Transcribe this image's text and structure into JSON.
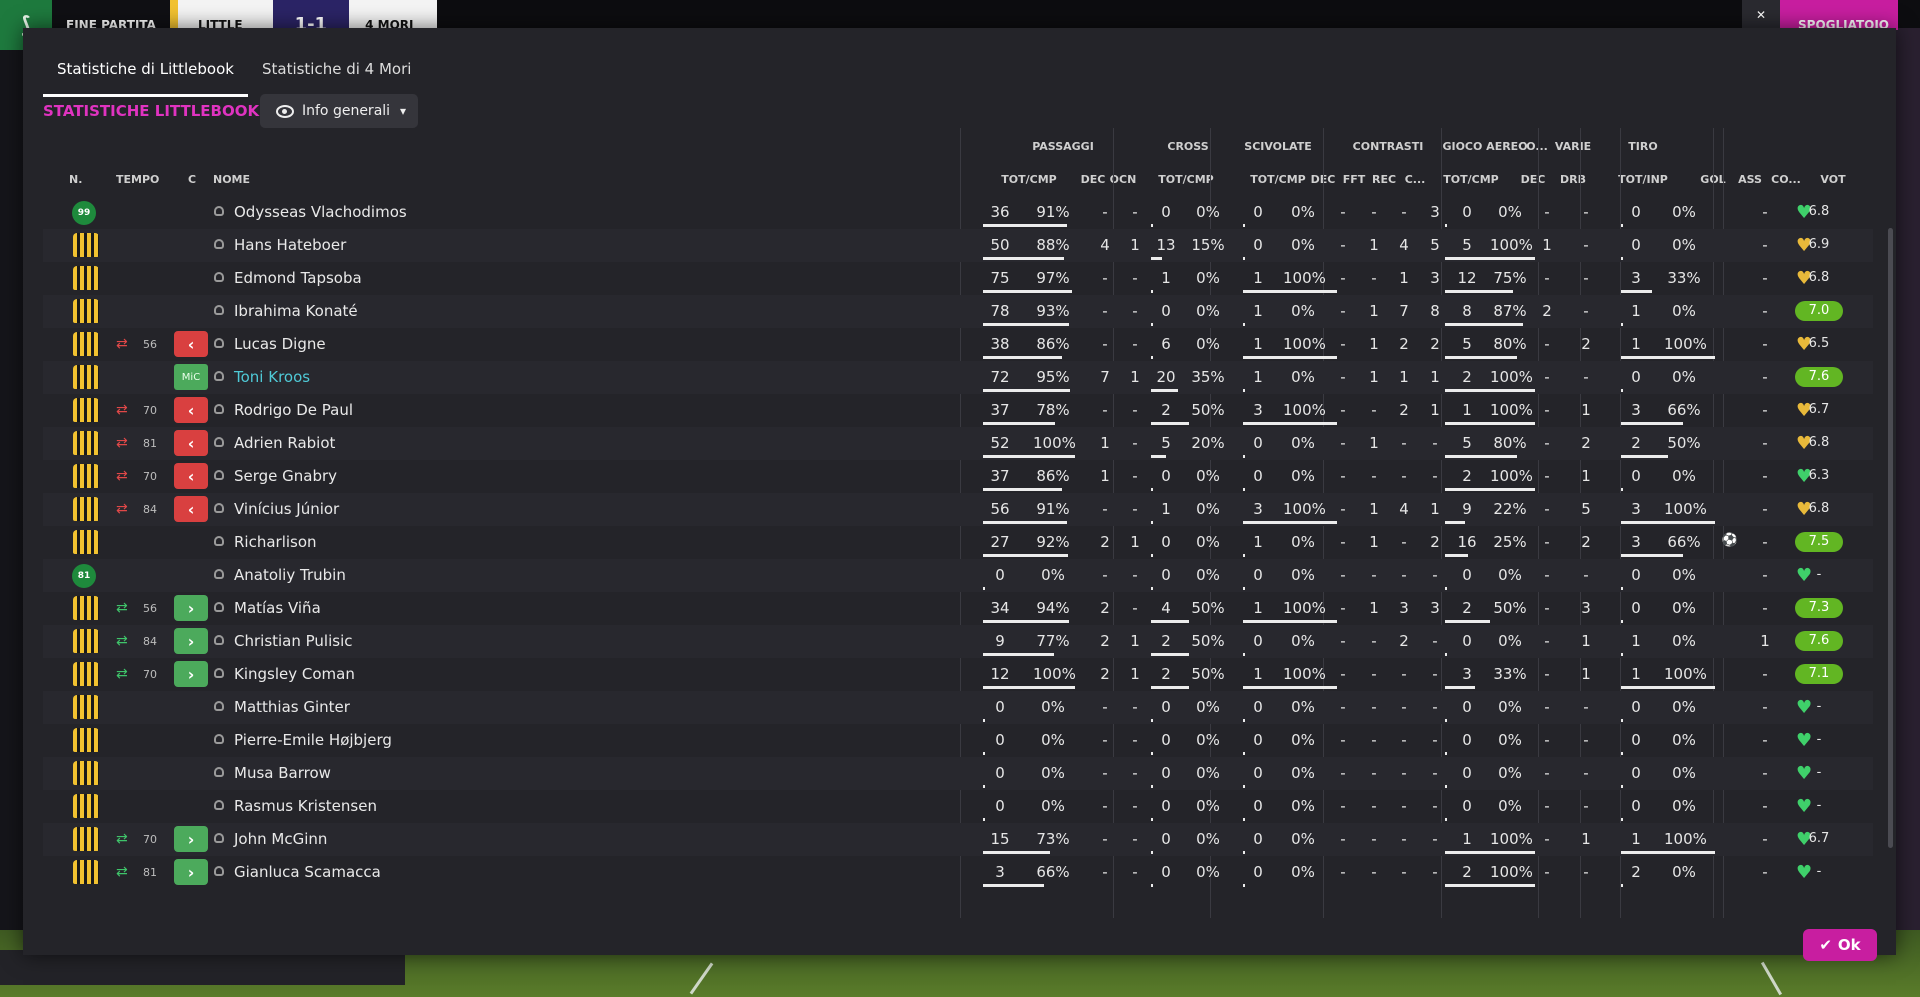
{
  "scoreboard": {
    "label": "FINE PARTITA",
    "home": "LITTLE",
    "score": "1-1",
    "away": "4 MORI",
    "close": "✕",
    "right_button": "SPOGLIATOIO"
  },
  "tabs": [
    "Statistiche di Littlebook",
    "Statistiche di 4 Mori"
  ],
  "section_title": "STATISTICHE LITTLEBOOK",
  "view_button": "Info generali",
  "ok_label": "Ok",
  "colors": {
    "accent": "#c81ea0",
    "home_kit": "#f2c230",
    "rating_high": "#62b623"
  },
  "columns": {
    "fixed": [
      "N.",
      "TEMPO",
      "C",
      "NOME"
    ],
    "groups": [
      {
        "label": "PASSAGGI",
        "subs": [
          "TOT/CMP",
          "DEC",
          "OCN"
        ]
      },
      {
        "label": "CROSS",
        "subs": [
          "TOT/CMP"
        ]
      },
      {
        "label": "SCIVOLATE",
        "subs": [
          "TOT/CMP"
        ]
      },
      {
        "label": "CONTRASTI",
        "subs": [
          "DEC",
          "FFT",
          "REC",
          "C..."
        ]
      },
      {
        "label": "GIOCO AEREO",
        "subs": [
          "TOT/CMP"
        ]
      },
      {
        "label": "CO...",
        "subs": [
          "DEC"
        ]
      },
      {
        "label": "VARIE",
        "subs": [
          "DRB"
        ]
      },
      {
        "label": "TIRO",
        "subs": [
          "TOT/INP"
        ]
      },
      {
        "label": "",
        "subs": [
          "GOL",
          "ASS",
          "CO...",
          "VOT"
        ]
      }
    ]
  },
  "players": [
    {
      "n": "99",
      "gk": true,
      "tempo": "",
      "sub": "",
      "name": "Odysseas Vlachodimos",
      "pass": [
        "36",
        "91%"
      ],
      "pdec": "-",
      "pocn": "-",
      "cross": [
        "0",
        "0%"
      ],
      "sciv": [
        "0",
        "0%"
      ],
      "con": [
        "-",
        "-",
        "-",
        "3"
      ],
      "aereo": [
        "0",
        "0%"
      ],
      "codec": "-",
      "drb": "-",
      "tiro": [
        "0",
        "0%"
      ],
      "gol": "",
      "ass": "-",
      "heart": "green",
      "vot": "6.8"
    },
    {
      "n": "",
      "gk": false,
      "tempo": "",
      "sub": "",
      "name": "Hans Hateboer",
      "pass": [
        "50",
        "88%"
      ],
      "pdec": "4",
      "pocn": "1",
      "cross": [
        "13",
        "15%"
      ],
      "sciv": [
        "0",
        "0%"
      ],
      "con": [
        "-",
        "1",
        "4",
        "5"
      ],
      "aereo": [
        "5",
        "100%"
      ],
      "codec": "1",
      "drb": "-",
      "tiro": [
        "0",
        "0%"
      ],
      "gol": "",
      "ass": "-",
      "heart": "gold",
      "vot": "6.9"
    },
    {
      "n": "",
      "gk": false,
      "tempo": "",
      "sub": "",
      "name": "Edmond Tapsoba",
      "pass": [
        "75",
        "97%"
      ],
      "pdec": "-",
      "pocn": "-",
      "cross": [
        "1",
        "0%"
      ],
      "sciv": [
        "1",
        "100%"
      ],
      "con": [
        "-",
        "-",
        "1",
        "3"
      ],
      "aereo": [
        "12",
        "75%"
      ],
      "codec": "-",
      "drb": "-",
      "tiro": [
        "3",
        "33%"
      ],
      "gol": "",
      "ass": "-",
      "heart": "gold",
      "vot": "6.8"
    },
    {
      "n": "",
      "gk": false,
      "tempo": "",
      "sub": "",
      "name": "Ibrahima Konaté",
      "pass": [
        "78",
        "93%"
      ],
      "pdec": "-",
      "pocn": "-",
      "cross": [
        "0",
        "0%"
      ],
      "sciv": [
        "1",
        "0%"
      ],
      "con": [
        "-",
        "1",
        "7",
        "8"
      ],
      "aereo": [
        "8",
        "87%"
      ],
      "codec": "2",
      "drb": "-",
      "tiro": [
        "1",
        "0%"
      ],
      "gol": "",
      "ass": "-",
      "heart": "gold",
      "vot": "7.0"
    },
    {
      "n": "",
      "gk": false,
      "tempo": "56",
      "sub": "out",
      "name": "Lucas Digne",
      "pass": [
        "38",
        "86%"
      ],
      "pdec": "-",
      "pocn": "-",
      "cross": [
        "6",
        "0%"
      ],
      "sciv": [
        "1",
        "100%"
      ],
      "con": [
        "-",
        "1",
        "2",
        "2"
      ],
      "aereo": [
        "5",
        "80%"
      ],
      "codec": "-",
      "drb": "2",
      "tiro": [
        "1",
        "100%"
      ],
      "gol": "",
      "ass": "-",
      "heart": "gold",
      "vot": "6.5"
    },
    {
      "n": "",
      "gk": false,
      "tempo": "",
      "sub": "MiC",
      "name": "Toni Kroos",
      "pass": [
        "72",
        "95%"
      ],
      "pdec": "7",
      "pocn": "1",
      "cross": [
        "20",
        "35%"
      ],
      "sciv": [
        "1",
        "0%"
      ],
      "con": [
        "-",
        "1",
        "1",
        "1"
      ],
      "aereo": [
        "2",
        "100%"
      ],
      "codec": "-",
      "drb": "-",
      "tiro": [
        "0",
        "0%"
      ],
      "gol": "",
      "ass": "-",
      "heart": "gold",
      "vot": "7.6"
    },
    {
      "n": "",
      "gk": false,
      "tempo": "70",
      "sub": "out",
      "name": "Rodrigo De Paul",
      "pass": [
        "37",
        "78%"
      ],
      "pdec": "-",
      "pocn": "-",
      "cross": [
        "2",
        "50%"
      ],
      "sciv": [
        "3",
        "100%"
      ],
      "con": [
        "-",
        "-",
        "2",
        "1"
      ],
      "aereo": [
        "1",
        "100%"
      ],
      "codec": "-",
      "drb": "1",
      "tiro": [
        "3",
        "66%"
      ],
      "gol": "",
      "ass": "-",
      "heart": "gold",
      "vot": "6.7"
    },
    {
      "n": "",
      "gk": false,
      "tempo": "81",
      "sub": "out",
      "name": "Adrien Rabiot",
      "pass": [
        "52",
        "100%"
      ],
      "pdec": "1",
      "pocn": "-",
      "cross": [
        "5",
        "20%"
      ],
      "sciv": [
        "0",
        "0%"
      ],
      "con": [
        "-",
        "1",
        "-",
        "-"
      ],
      "aereo": [
        "5",
        "80%"
      ],
      "codec": "-",
      "drb": "2",
      "tiro": [
        "2",
        "50%"
      ],
      "gol": "",
      "ass": "-",
      "heart": "gold",
      "vot": "6.8"
    },
    {
      "n": "",
      "gk": false,
      "tempo": "70",
      "sub": "out",
      "name": "Serge Gnabry",
      "pass": [
        "37",
        "86%"
      ],
      "pdec": "1",
      "pocn": "-",
      "cross": [
        "0",
        "0%"
      ],
      "sciv": [
        "0",
        "0%"
      ],
      "con": [
        "-",
        "-",
        "-",
        "-"
      ],
      "aereo": [
        "2",
        "100%"
      ],
      "codec": "-",
      "drb": "1",
      "tiro": [
        "0",
        "0%"
      ],
      "gol": "",
      "ass": "-",
      "heart": "green",
      "vot": "6.3"
    },
    {
      "n": "",
      "gk": false,
      "tempo": "84",
      "sub": "out",
      "name": "Vinícius Júnior",
      "pass": [
        "56",
        "91%"
      ],
      "pdec": "-",
      "pocn": "-",
      "cross": [
        "1",
        "0%"
      ],
      "sciv": [
        "3",
        "100%"
      ],
      "con": [
        "-",
        "1",
        "4",
        "1"
      ],
      "aereo": [
        "9",
        "22%"
      ],
      "codec": "-",
      "drb": "5",
      "tiro": [
        "3",
        "100%"
      ],
      "gol": "",
      "ass": "-",
      "heart": "gold",
      "vot": "6.8"
    },
    {
      "n": "",
      "gk": false,
      "tempo": "",
      "sub": "",
      "name": "Richarlison",
      "pass": [
        "27",
        "92%"
      ],
      "pdec": "2",
      "pocn": "1",
      "cross": [
        "0",
        "0%"
      ],
      "sciv": [
        "1",
        "0%"
      ],
      "con": [
        "-",
        "1",
        "-",
        "2"
      ],
      "aereo": [
        "16",
        "25%"
      ],
      "codec": "-",
      "drb": "2",
      "tiro": [
        "3",
        "66%"
      ],
      "gol": "⚽",
      "ass": "-",
      "heart": "gold",
      "vot": "7.5"
    },
    {
      "n": "81",
      "gk": true,
      "tempo": "",
      "sub": "",
      "name": "Anatoliy Trubin",
      "pass": [
        "0",
        "0%"
      ],
      "pdec": "-",
      "pocn": "-",
      "cross": [
        "0",
        "0%"
      ],
      "sciv": [
        "0",
        "0%"
      ],
      "con": [
        "-",
        "-",
        "-",
        "-"
      ],
      "aereo": [
        "0",
        "0%"
      ],
      "codec": "-",
      "drb": "-",
      "tiro": [
        "0",
        "0%"
      ],
      "gol": "",
      "ass": "-",
      "heart": "green",
      "vot": "-"
    },
    {
      "n": "",
      "gk": false,
      "tempo": "56",
      "sub": "in",
      "name": "Matías Viña",
      "pass": [
        "34",
        "94%"
      ],
      "pdec": "2",
      "pocn": "-",
      "cross": [
        "4",
        "50%"
      ],
      "sciv": [
        "1",
        "100%"
      ],
      "con": [
        "-",
        "1",
        "3",
        "3"
      ],
      "aereo": [
        "2",
        "50%"
      ],
      "codec": "-",
      "drb": "3",
      "tiro": [
        "0",
        "0%"
      ],
      "gol": "",
      "ass": "-",
      "heart": "green",
      "vot": "7.3"
    },
    {
      "n": "",
      "gk": false,
      "tempo": "84",
      "sub": "in",
      "name": "Christian Pulisic",
      "pass": [
        "9",
        "77%"
      ],
      "pdec": "2",
      "pocn": "1",
      "cross": [
        "2",
        "50%"
      ],
      "sciv": [
        "0",
        "0%"
      ],
      "con": [
        "-",
        "-",
        "2",
        "-"
      ],
      "aereo": [
        "0",
        "0%"
      ],
      "codec": "-",
      "drb": "1",
      "tiro": [
        "1",
        "0%"
      ],
      "gol": "",
      "ass": "1",
      "heart": "green",
      "vot": "7.6"
    },
    {
      "n": "",
      "gk": false,
      "tempo": "70",
      "sub": "in",
      "name": "Kingsley Coman",
      "pass": [
        "12",
        "100%"
      ],
      "pdec": "2",
      "pocn": "1",
      "cross": [
        "2",
        "50%"
      ],
      "sciv": [
        "1",
        "100%"
      ],
      "con": [
        "-",
        "-",
        "-",
        "-"
      ],
      "aereo": [
        "3",
        "33%"
      ],
      "codec": "-",
      "drb": "1",
      "tiro": [
        "1",
        "100%"
      ],
      "gol": "",
      "ass": "-",
      "heart": "green",
      "vot": "7.1"
    },
    {
      "n": "",
      "gk": false,
      "tempo": "",
      "sub": "",
      "name": "Matthias Ginter",
      "pass": [
        "0",
        "0%"
      ],
      "pdec": "-",
      "pocn": "-",
      "cross": [
        "0",
        "0%"
      ],
      "sciv": [
        "0",
        "0%"
      ],
      "con": [
        "-",
        "-",
        "-",
        "-"
      ],
      "aereo": [
        "0",
        "0%"
      ],
      "codec": "-",
      "drb": "-",
      "tiro": [
        "0",
        "0%"
      ],
      "gol": "",
      "ass": "-",
      "heart": "green",
      "vot": "-"
    },
    {
      "n": "",
      "gk": false,
      "tempo": "",
      "sub": "",
      "name": "Pierre-Emile Højbjerg",
      "pass": [
        "0",
        "0%"
      ],
      "pdec": "-",
      "pocn": "-",
      "cross": [
        "0",
        "0%"
      ],
      "sciv": [
        "0",
        "0%"
      ],
      "con": [
        "-",
        "-",
        "-",
        "-"
      ],
      "aereo": [
        "0",
        "0%"
      ],
      "codec": "-",
      "drb": "-",
      "tiro": [
        "0",
        "0%"
      ],
      "gol": "",
      "ass": "-",
      "heart": "green",
      "vot": "-"
    },
    {
      "n": "",
      "gk": false,
      "tempo": "",
      "sub": "",
      "name": "Musa Barrow",
      "pass": [
        "0",
        "0%"
      ],
      "pdec": "-",
      "pocn": "-",
      "cross": [
        "0",
        "0%"
      ],
      "sciv": [
        "0",
        "0%"
      ],
      "con": [
        "-",
        "-",
        "-",
        "-"
      ],
      "aereo": [
        "0",
        "0%"
      ],
      "codec": "-",
      "drb": "-",
      "tiro": [
        "0",
        "0%"
      ],
      "gol": "",
      "ass": "-",
      "heart": "green",
      "vot": "-"
    },
    {
      "n": "",
      "gk": false,
      "tempo": "",
      "sub": "",
      "name": "Rasmus Kristensen",
      "pass": [
        "0",
        "0%"
      ],
      "pdec": "-",
      "pocn": "-",
      "cross": [
        "0",
        "0%"
      ],
      "sciv": [
        "0",
        "0%"
      ],
      "con": [
        "-",
        "-",
        "-",
        "-"
      ],
      "aereo": [
        "0",
        "0%"
      ],
      "codec": "-",
      "drb": "-",
      "tiro": [
        "0",
        "0%"
      ],
      "gol": "",
      "ass": "-",
      "heart": "green",
      "vot": "-"
    },
    {
      "n": "",
      "gk": false,
      "tempo": "70",
      "sub": "in",
      "name": "John McGinn",
      "pass": [
        "15",
        "73%"
      ],
      "pdec": "-",
      "pocn": "-",
      "cross": [
        "0",
        "0%"
      ],
      "sciv": [
        "0",
        "0%"
      ],
      "con": [
        "-",
        "-",
        "-",
        "-"
      ],
      "aereo": [
        "1",
        "100%"
      ],
      "codec": "-",
      "drb": "1",
      "tiro": [
        "1",
        "100%"
      ],
      "gol": "",
      "ass": "-",
      "heart": "green",
      "vot": "6.7"
    },
    {
      "n": "",
      "gk": false,
      "tempo": "81",
      "sub": "in",
      "name": "Gianluca Scamacca",
      "pass": [
        "3",
        "66%"
      ],
      "pdec": "-",
      "pocn": "-",
      "cross": [
        "0",
        "0%"
      ],
      "sciv": [
        "0",
        "0%"
      ],
      "con": [
        "-",
        "-",
        "-",
        "-"
      ],
      "aereo": [
        "2",
        "100%"
      ],
      "codec": "-",
      "drb": "-",
      "tiro": [
        "2",
        "0%"
      ],
      "gol": "",
      "ass": "-",
      "heart": "green",
      "vot": "-"
    }
  ]
}
